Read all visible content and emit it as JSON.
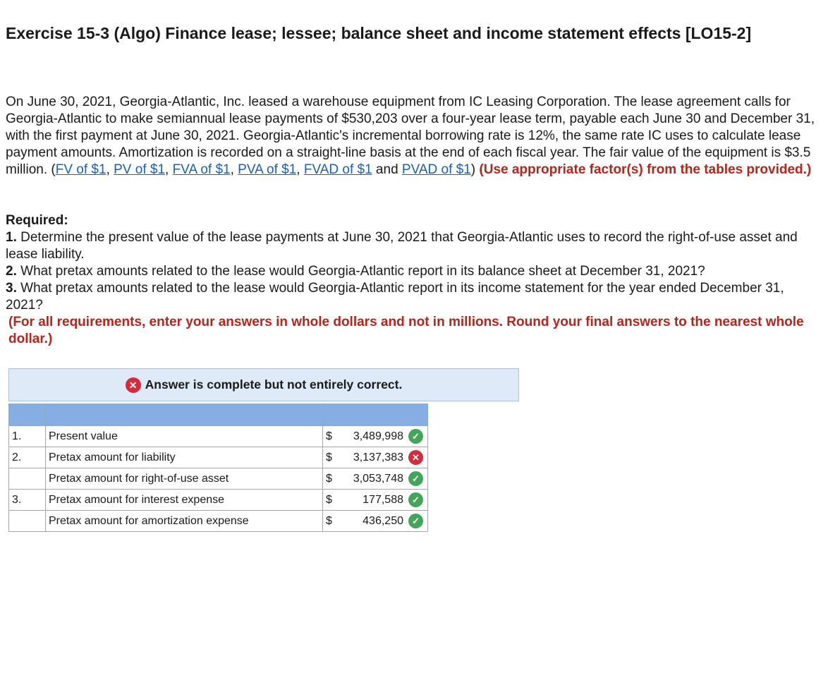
{
  "title": "Exercise 15-3 (Algo) Finance lease; lessee; balance sheet and income statement effects [LO15-2]",
  "intro": {
    "text": "On June 30, 2021, Georgia-Atlantic, Inc. leased a warehouse equipment  from IC Leasing Corporation. The lease agreement calls for Georgia-Atlantic to make semiannual lease payments of $530,203 over a four-year lease term, payable each June 30 and December 31, with the first payment at June 30, 2021. Georgia-Atlantic's incremental borrowing rate is 12%, the same rate IC uses to calculate lease payment amounts. Amortization is recorded on a straight-line basis at the end of each fiscal year. The fair value of the equipment is $3.5 million. (",
    "links": [
      "FV of $1",
      "PV of $1",
      "FVA of $1",
      "PVA of $1",
      "FVAD of $1",
      "PVAD of $1"
    ],
    "sep": ", ",
    "and": " and ",
    "close": ")",
    "instruction": "(Use appropriate factor(s) from the tables provided.)"
  },
  "required": {
    "heading": "Required:",
    "items": [
      {
        "num": "1.",
        "text": "Determine the present value of the lease payments at June 30, 2021 that Georgia-Atlantic uses to record the right-of-use asset and lease liability."
      },
      {
        "num": "2.",
        "text": "What pretax amounts related to the lease would Georgia-Atlantic report in its balance sheet at December 31, 2021?"
      },
      {
        "num": "3.",
        "text": "What pretax amounts related to the lease would Georgia-Atlantic report in its income statement for the year ended December 31, 2021?"
      }
    ],
    "note": "(For all requirements, enter your answers in whole dollars and not in millions. Round your final answers to the nearest whole dollar.)"
  },
  "banner": {
    "icon": "x-icon",
    "text": "Answer is complete but not entirely correct."
  },
  "table": {
    "rows": [
      {
        "num": "1.",
        "label": "Present value",
        "currency": "$",
        "value": "3,489,998",
        "status": "correct"
      },
      {
        "num": "2.",
        "label": "Pretax amount for liability",
        "currency": "$",
        "value": "3,137,383",
        "status": "incorrect"
      },
      {
        "num": "",
        "label": "Pretax amount for right-of-use asset",
        "currency": "$",
        "value": "3,053,748",
        "status": "correct"
      },
      {
        "num": "3.",
        "label": "Pretax amount for interest expense",
        "currency": "$",
        "value": "177,588",
        "status": "correct"
      },
      {
        "num": "",
        "label": "Pretax amount for amortization expense",
        "currency": "$",
        "value": "436,250",
        "status": "correct"
      }
    ]
  },
  "colors": {
    "accent_red": "#b3261e",
    "link_blue": "#1e5fb4",
    "banner_bg": "#deeaf7",
    "header_blue": "#86aee3",
    "correct_green": "#42a65a",
    "incorrect_red": "#d52b3a"
  }
}
